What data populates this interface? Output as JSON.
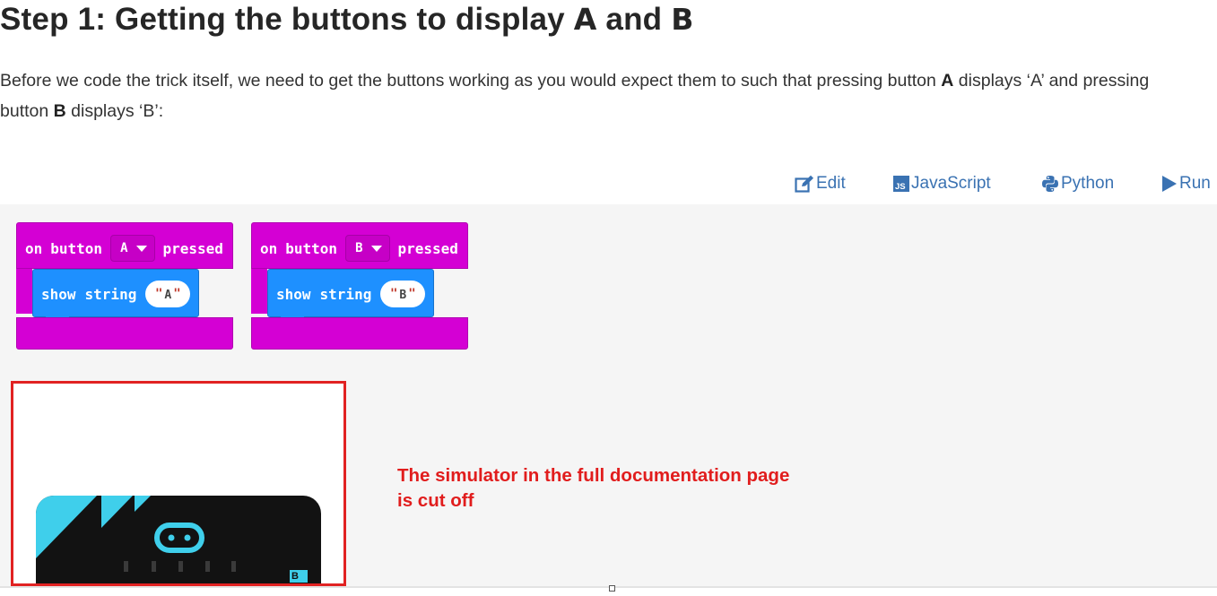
{
  "title": {
    "prefix": "Step 1: Getting the buttons to display ",
    "a": "A",
    "and": " and ",
    "b": "B"
  },
  "intro": {
    "t1": "Before we code the trick itself, we need to get the buttons working as you would expect them to such that pressing button ",
    "a": "A",
    "t2": " displays ‘A’ and pressing button ",
    "b": "B",
    "t3": " displays ‘B’:"
  },
  "toolbar": {
    "edit": "Edit",
    "javascript": "JavaScript",
    "python": "Python",
    "run": "Run",
    "js_badge": "JS"
  },
  "blocks": [
    {
      "on": "on",
      "button": "button",
      "key": "A",
      "pressed": "pressed",
      "show": "show",
      "string": "string",
      "quote_open": "\"",
      "value": "A",
      "quote_close": "\""
    },
    {
      "on": "on",
      "button": "button",
      "key": "B",
      "pressed": "pressed",
      "show": "show",
      "string": "string",
      "quote_open": "\"",
      "value": "B",
      "quote_close": "\""
    }
  ],
  "simulator": {
    "badge": "B"
  },
  "annotation": {
    "line1": "The simulator in the full documentation page",
    "line2": "is cut off"
  },
  "colors": {
    "event_block": "#d400d4",
    "basic_block": "#1e90ff",
    "link": "#3a72b2",
    "annotation": "#e11d1d",
    "microbit_accent": "#3fcfeb"
  }
}
